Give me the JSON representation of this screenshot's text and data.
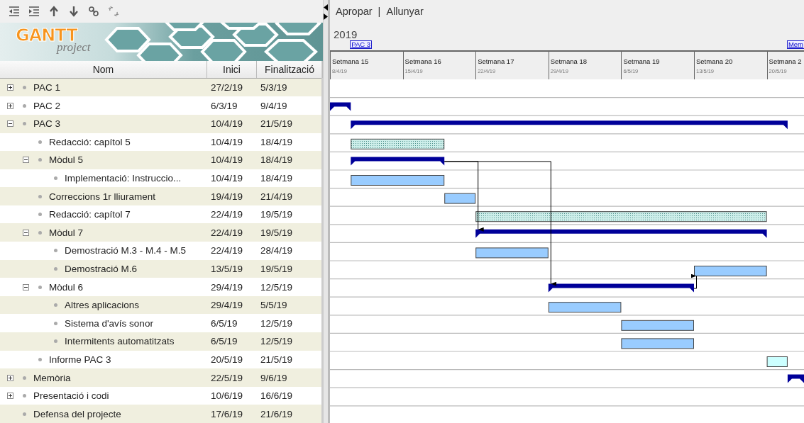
{
  "logo": {
    "title": "GANTT",
    "subtitle": "project"
  },
  "columns": [
    "Nom",
    "Inici",
    "Finalització"
  ],
  "zoom": {
    "zoom_in": "Apropar",
    "separator": "|",
    "zoom_out": "Allunyar"
  },
  "timeline": {
    "year": "2019",
    "weeks": [
      {
        "label": "Setmana 15",
        "date": "8/4/19"
      },
      {
        "label": "Setmana 16",
        "date": "15/4/19"
      },
      {
        "label": "Setmana 17",
        "date": "22/4/19"
      },
      {
        "label": "Setmana 18",
        "date": "29/4/19"
      },
      {
        "label": "Setmana 19",
        "date": "6/5/19"
      },
      {
        "label": "Setmana 20",
        "date": "13/5/19"
      },
      {
        "label": "Setmana 2",
        "date": "20/5/19"
      }
    ]
  },
  "tasks": [
    {
      "name": "PAC 1",
      "start": "27/2/19",
      "end": "5/3/19",
      "expanded": false
    },
    {
      "name": "PAC 2",
      "start": "6/3/19",
      "end": "9/4/19",
      "expanded": false,
      "bar": {
        "kind": "summary"
      }
    },
    {
      "name": "PAC 3",
      "start": "10/4/19",
      "end": "21/5/19",
      "expanded": true,
      "timeline_label": "PAC 3",
      "bar": {
        "kind": "summary"
      },
      "children": [
        {
          "name": "Redacció: capítol 5",
          "start": "10/4/19",
          "end": "18/4/19",
          "bar": {
            "kind": "task",
            "color": "#cdeeea",
            "hatched": true
          }
        },
        {
          "name": "Mòdul 5",
          "start": "10/4/19",
          "end": "18/4/19",
          "expanded": true,
          "bar": {
            "kind": "summary"
          },
          "children": [
            {
              "name": "Implementació: Instruccio...",
              "start": "10/4/19",
              "end": "18/4/19",
              "bar": {
                "kind": "task",
                "color": "#99ccff",
                "hatched": false
              }
            }
          ]
        },
        {
          "name": "Correccions 1r lliurament",
          "start": "19/4/19",
          "end": "21/4/19",
          "bar": {
            "kind": "task",
            "color": "#99ccff",
            "hatched": false
          }
        },
        {
          "name": "Redacció: capítol 7",
          "start": "22/4/19",
          "end": "19/5/19",
          "bar": {
            "kind": "task",
            "color": "#cdeeea",
            "hatched": true
          }
        },
        {
          "name": "Mòdul 7",
          "start": "22/4/19",
          "end": "19/5/19",
          "expanded": true,
          "bar": {
            "kind": "summary"
          },
          "children": [
            {
              "name": "Demostració M.3 - M.4 - M.5",
              "start": "22/4/19",
              "end": "28/4/19",
              "bar": {
                "kind": "task",
                "color": "#99ccff",
                "hatched": false
              }
            },
            {
              "name": "Demostració M.6",
              "start": "13/5/19",
              "end": "19/5/19",
              "bar": {
                "kind": "task",
                "color": "#99ccff",
                "hatched": false
              }
            }
          ]
        },
        {
          "name": "Mòdul 6",
          "start": "29/4/19",
          "end": "12/5/19",
          "expanded": true,
          "bar": {
            "kind": "summary"
          },
          "children": [
            {
              "name": "Altres aplicacions",
              "start": "29/4/19",
              "end": "5/5/19",
              "bar": {
                "kind": "task",
                "color": "#99ccff",
                "hatched": false
              }
            },
            {
              "name": "Sistema d'avís sonor",
              "start": "6/5/19",
              "end": "12/5/19",
              "bar": {
                "kind": "task",
                "color": "#99ccff",
                "hatched": false
              }
            },
            {
              "name": "Intermitents automatitzats",
              "start": "6/5/19",
              "end": "12/5/19",
              "bar": {
                "kind": "task",
                "color": "#99ccff",
                "hatched": false
              }
            }
          ]
        },
        {
          "name": "Informe PAC 3",
          "start": "20/5/19",
          "end": "21/5/19",
          "bar": {
            "kind": "task",
            "color": "#ccffff",
            "hatched": false
          }
        }
      ]
    },
    {
      "name": "Memòria",
      "start": "22/5/19",
      "end": "9/6/19",
      "expanded": false,
      "timeline_label": "Mem",
      "bar": {
        "kind": "summary"
      }
    },
    {
      "name": "Presentació i codi",
      "start": "10/6/19",
      "end": "16/6/19",
      "expanded": false
    },
    {
      "name": "Defensa del projecte",
      "start": "17/6/19",
      "end": "21/6/19"
    }
  ]
}
